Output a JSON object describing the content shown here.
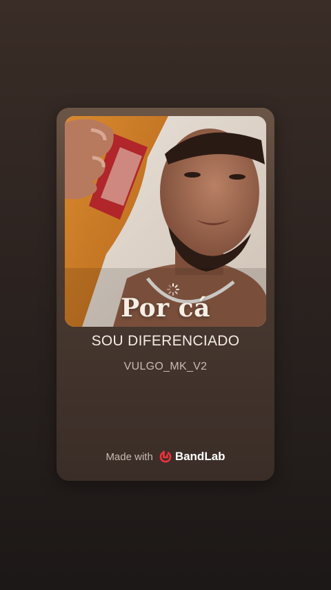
{
  "card": {
    "cover_text": "Por cá",
    "song_title": "SOU DIFERENCIADO",
    "artist": "VULGO_MK_V2",
    "loading_indicator": "spinner-icon"
  },
  "footer": {
    "made_with_label": "Made with",
    "brand_name": "BandLab",
    "brand_icon": "bandlab-logo-icon",
    "brand_color": "#f0323c"
  },
  "colors": {
    "background_top": "#3a2d27",
    "background_bottom": "#1c1817",
    "card": "#4a3a31",
    "title_text": "#f3ece6",
    "artist_text": "#c9bcb3"
  }
}
